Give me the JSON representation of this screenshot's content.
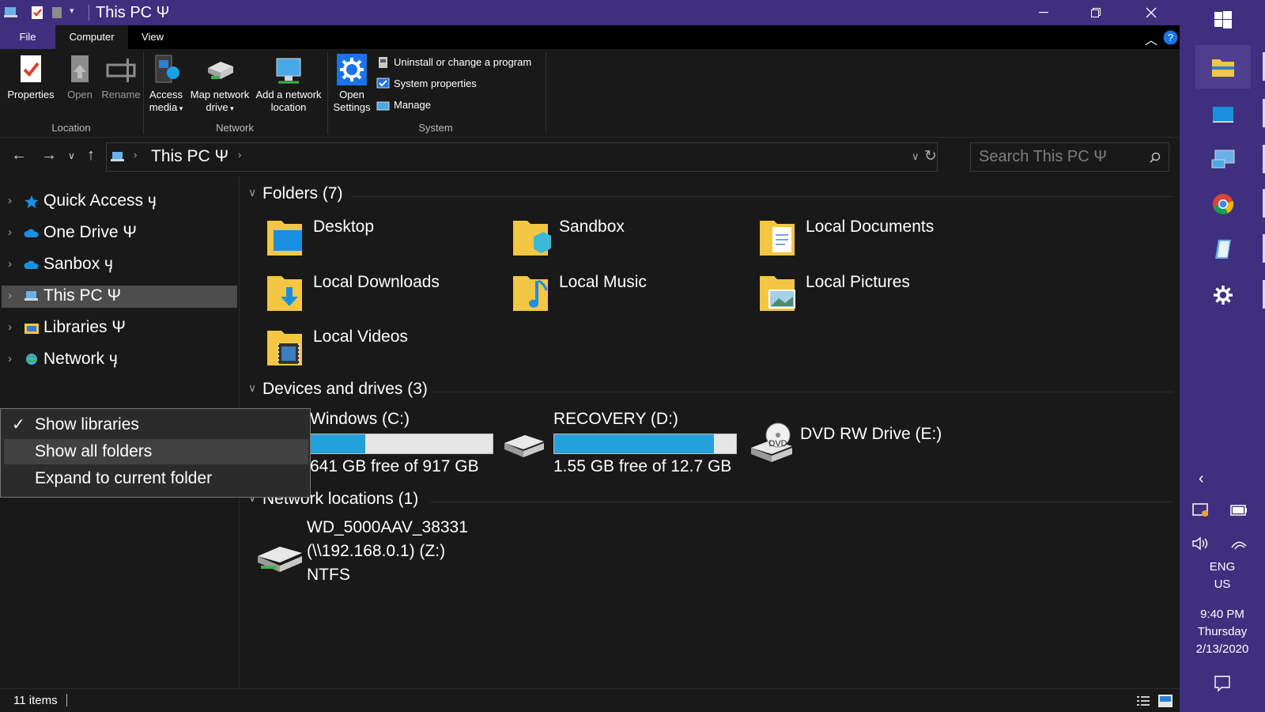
{
  "window": {
    "title": "This PC Ψ",
    "minimize_icon": "minimize-icon",
    "maximize_icon": "restore-icon",
    "close_icon": "close-icon"
  },
  "ribbon": {
    "tabs": [
      {
        "label": "File"
      },
      {
        "label": "Computer"
      },
      {
        "label": "View"
      }
    ],
    "location_group": {
      "label": "Location",
      "properties": "Properties",
      "open": "Open",
      "rename": "Rename"
    },
    "network_group": {
      "label": "Network",
      "access_media_1": "Access",
      "access_media_2": "media",
      "map_drive_1": "Map network",
      "map_drive_2": "drive",
      "add_location_1": "Add a network",
      "add_location_2": "location"
    },
    "system_group": {
      "label": "System",
      "open_settings_1": "Open",
      "open_settings_2": "Settings",
      "uninstall": "Uninstall or change a program",
      "system_properties": "System properties",
      "manage": "Manage"
    }
  },
  "address": {
    "path": "This PC Ψ",
    "search_placeholder": "Search This PC Ψ"
  },
  "nav": {
    "items": [
      {
        "label": "Quick Access ӌ",
        "icon": "star-icon"
      },
      {
        "label": "One Drive Ψ",
        "icon": "cloud-icon"
      },
      {
        "label": "Sanbox ӌ",
        "icon": "cloud-icon"
      },
      {
        "label": "This PC Ψ",
        "icon": "computer-icon",
        "selected": true
      },
      {
        "label": "Libraries Ψ",
        "icon": "library-icon"
      },
      {
        "label": "Network ӌ",
        "icon": "network-icon"
      }
    ]
  },
  "context_menu": {
    "items": [
      {
        "label": "Show libraries",
        "checked": true
      },
      {
        "label": "Show all folders",
        "hovered": true
      },
      {
        "label": "Expand to current folder"
      }
    ]
  },
  "content": {
    "folders_header": "Folders (7)",
    "folders": [
      {
        "label": "Desktop"
      },
      {
        "label": "Sandbox"
      },
      {
        "label": "Local Documents"
      },
      {
        "label": "Local Downloads"
      },
      {
        "label": "Local Music"
      },
      {
        "label": "Local Pictures"
      },
      {
        "label": "Local Videos"
      }
    ],
    "devices_header": "Devices and drives (3)",
    "drives": [
      {
        "label": "Windows (C:)",
        "free": "641 GB free of 917 GB",
        "used_fraction": 0.3
      },
      {
        "label": "RECOVERY (D:)",
        "free": "1.55 GB free of 12.7 GB",
        "used_fraction": 0.88
      },
      {
        "label": "DVD RW Drive (E:)",
        "disc_label": "DVD"
      }
    ],
    "network_header": "Network locations (1)",
    "network_locations": [
      {
        "line1": "WD_5000AAV_38331",
        "line2": "(\\\\192.168.0.1) (Z:)",
        "line3": "NTFS"
      }
    ]
  },
  "status": {
    "items_count": "11 items"
  },
  "taskbar": {
    "language_1": "ENG",
    "language_2": "US",
    "time": "9:40 PM",
    "day": "Thursday",
    "date": "2/13/2020"
  }
}
